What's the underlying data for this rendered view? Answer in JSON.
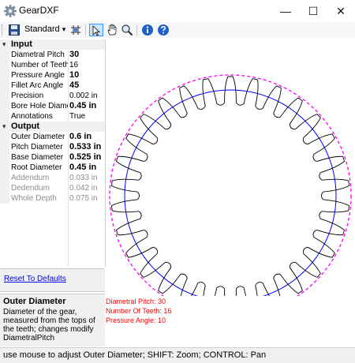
{
  "window": {
    "title": "GearDXF",
    "minimize_glyph": "—",
    "maximize_glyph": "☐",
    "close_glyph": "✕"
  },
  "toolbar": {
    "icons": [
      "save-icon",
      "standard-dropdown",
      "grid-icon",
      "pointer-icon",
      "hand-icon",
      "zoom-icon",
      "info-icon",
      "help-icon"
    ],
    "standard_label": "Standard",
    "dropdown_glyph": "▾"
  },
  "property_grid": {
    "input_category": "Input",
    "input_properties": [
      {
        "name": "Diametral Pitch",
        "value": "30",
        "bold": true
      },
      {
        "name": "Number of Teeth",
        "value": "16",
        "bold": false
      },
      {
        "name": "Pressure Angle",
        "value": "10",
        "bold": true
      },
      {
        "name": "Fillet Arc Angle",
        "value": "45",
        "bold": true
      },
      {
        "name": "Precision",
        "value": "0.002 in",
        "bold": false
      },
      {
        "name": "Bore Hole Diame",
        "value": "0.45 in",
        "bold": true
      },
      {
        "name": "Annotations",
        "value": "True",
        "bold": false
      }
    ],
    "output_category": "Output",
    "output_properties": [
      {
        "name": "Outer Diameter",
        "value": "0.6 in",
        "bold": true,
        "disabled": false
      },
      {
        "name": "Pitch Diameter",
        "value": "0.533 in",
        "bold": true,
        "disabled": false
      },
      {
        "name": "Base Diameter",
        "value": "0.525 in",
        "bold": true,
        "disabled": false
      },
      {
        "name": "Root Diameter",
        "value": "0.45 in",
        "bold": true,
        "disabled": false
      },
      {
        "name": "Addendum",
        "value": "0.033 in",
        "bold": false,
        "disabled": true
      },
      {
        "name": "Dedendum",
        "value": "0.042 in",
        "bold": false,
        "disabled": true
      },
      {
        "name": "Whole Depth",
        "value": "0.075 in",
        "bold": false,
        "disabled": true
      }
    ]
  },
  "reset_link": "Reset To Defaults",
  "help": {
    "title": "Outer Diameter",
    "description": "Diameter of the gear, measured from the tops of the teeth; changes modify DiametralPitch"
  },
  "gear_info": {
    "line1": "Diametral Pitch: 30",
    "line2": "Number Of Teeth: 16",
    "line3": "Pressure Angle: 10"
  },
  "gear_drawing": {
    "teeth": 16,
    "outer_circle_color": "#ff00ff",
    "base_circle_color": "#0000ff",
    "profile_color": "#000000"
  },
  "status_text": "use mouse to adjust Outer Diameter; SHIFT: Zoom; CONTROL: Pan"
}
